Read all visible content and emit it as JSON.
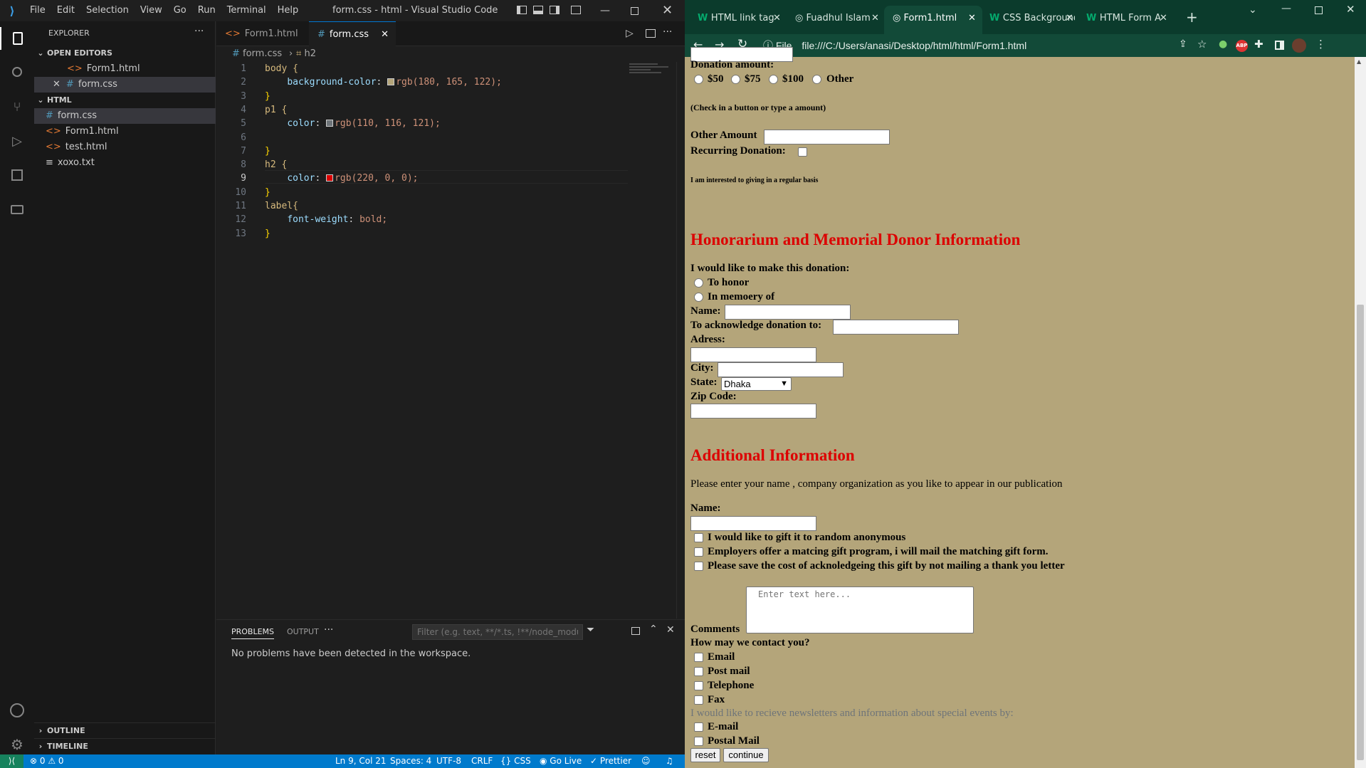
{
  "vscode": {
    "menu": [
      "File",
      "Edit",
      "Selection",
      "View",
      "Go",
      "Run",
      "Terminal",
      "Help"
    ],
    "title": "form.css - html - Visual Studio Code",
    "explorer_title": "EXPLORER",
    "open_editors_label": "OPEN EDITORS",
    "open_editors": [
      {
        "name": "Form1.html",
        "icon": "html-icon"
      },
      {
        "name": "form.css",
        "icon": "css-icon"
      }
    ],
    "folder_label": "HTML",
    "files": [
      {
        "name": "form.css",
        "icon": "#"
      },
      {
        "name": "Form1.html",
        "icon": "<>"
      },
      {
        "name": "test.html",
        "icon": "<>"
      },
      {
        "name": "xoxo.txt",
        "icon": "≡"
      }
    ],
    "outline_label": "OUTLINE",
    "timeline_label": "TIMELINE",
    "tabs": [
      {
        "label": "Form1.html"
      },
      {
        "label": "form.css"
      }
    ],
    "breadcrumb": {
      "file": "form.css",
      "symbol": "h2"
    },
    "code_lines": [
      {
        "n": "1",
        "text": "body {"
      },
      {
        "n": "2",
        "text": "    background-color: ",
        "color_swatch": "#b4a57a",
        "after": "rgb(180, 165, 122);"
      },
      {
        "n": "3",
        "text": "}"
      },
      {
        "n": "4",
        "text": "p1 {"
      },
      {
        "n": "5",
        "text": "    color: ",
        "color_swatch": "#6e7479",
        "after": "rgb(110, 116, 121);"
      },
      {
        "n": "6",
        "text": ""
      },
      {
        "n": "7",
        "text": "}"
      },
      {
        "n": "8",
        "text": "h2 {"
      },
      {
        "n": "9",
        "text": "    color: ",
        "color_swatch": "#dc0000",
        "after": "rgb(220, 0, 0);"
      },
      {
        "n": "10",
        "text": "}"
      },
      {
        "n": "11",
        "text": "label{"
      },
      {
        "n": "12",
        "text": "    font-weight: bold;"
      },
      {
        "n": "13",
        "text": "}"
      }
    ],
    "panel": {
      "tabs": [
        "PROBLEMS",
        "OUTPUT"
      ],
      "filter_placeholder": "Filter (e.g. text, **/*.ts, !**/node_modules/**)",
      "message": "No problems have been detected in the workspace."
    },
    "status": {
      "errors": "0",
      "warnings": "0",
      "position": "Ln 9, Col 21",
      "spaces": "Spaces: 4",
      "encoding": "UTF-8",
      "eol": "CRLF",
      "language": "CSS",
      "golive": "Go Live",
      "prettier": "Prettier"
    }
  },
  "browser": {
    "tabs": [
      {
        "label": "HTML link tag"
      },
      {
        "label": "Fuadhul Islam"
      },
      {
        "label": "Form1.html"
      },
      {
        "label": "CSS Background"
      },
      {
        "label": "HTML Form A"
      }
    ],
    "address_scheme": "File",
    "address": "file:///C:/Users/anasi/Desktop/html/html/Form1.html",
    "ext_abp": "ABP",
    "page": {
      "donation_amount_label": "Donation amount:",
      "amounts": [
        "$50",
        "$75",
        "$100",
        "Other"
      ],
      "check_note": "(Check in a button or type a amount)",
      "other_amount_label": "Other Amount",
      "recurring_label": "Recurring Donation:",
      "regular_note": "I am interested to giving in a regular basis",
      "h2_honor": "Honorarium and Memorial Donor Information",
      "make_donation_label": "I would like to make this donation:",
      "to_honor": "To honor",
      "in_memory": "In memoery of",
      "name_label": "Name:",
      "acknowledge_label": "To acknowledge donation to:",
      "address_label": "Adress:",
      "city_label": "City:",
      "state_label": "State:",
      "state_value": "Dhaka",
      "zip_label": "Zip Code:",
      "h2_additional": "Additional Information",
      "publication_text": "Please enter your name , company organization as you like to appear in our publication",
      "name2_label": "Name:",
      "gift_options": [
        "I would like to gift it to random anonymous",
        "Employers offer a matcing gift program, i will mail the matching gift form.",
        "Please save the cost of acknoledgeing this gift by not mailing a thank you letter"
      ],
      "comments_label": "Comments",
      "comments_placeholder": "Enter text here...",
      "contact_label": "How may we contact you?",
      "contact_options": [
        "Email",
        "Post mail",
        "Telephone",
        "Fax"
      ],
      "newsletter_text": "I would like to recieve newsletters and information about special events by:",
      "newsletter_options": [
        "E-mail",
        "Postal Mail"
      ],
      "reset_label": "reset",
      "continue_label": "continue"
    }
  }
}
